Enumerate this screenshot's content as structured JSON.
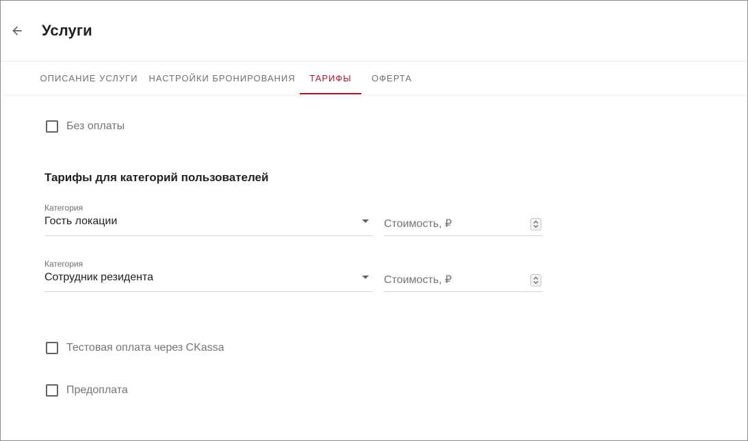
{
  "header": {
    "back_icon": "arrow-left-icon",
    "title": "Услуги"
  },
  "tabs": [
    {
      "label": "Описание услуги",
      "active": false
    },
    {
      "label": "Настройки бронирования",
      "active": false
    },
    {
      "label": "Тарифы",
      "active": true
    },
    {
      "label": "Оферта",
      "active": false
    }
  ],
  "colors": {
    "accent": "#b3122b",
    "text_primary": "#212121",
    "text_secondary": "#70757a",
    "divider": "#d6d6d6"
  },
  "free": {
    "label": "Без оплаты",
    "checked": false
  },
  "section_title": "Тарифы для категорий пользователей",
  "tariffs": [
    {
      "category_label": "Категория",
      "category_value": "Гость локации",
      "price_placeholder": "Стоимость, ₽",
      "price_value": ""
    },
    {
      "category_label": "Категория",
      "category_value": "Сотрудник резидента",
      "price_placeholder": "Стоимость, ₽",
      "price_value": ""
    }
  ],
  "test_payment": {
    "label": "Тестовая оплата через CKassa",
    "checked": false
  },
  "prepayment": {
    "label": "Предоплата",
    "checked": false
  }
}
